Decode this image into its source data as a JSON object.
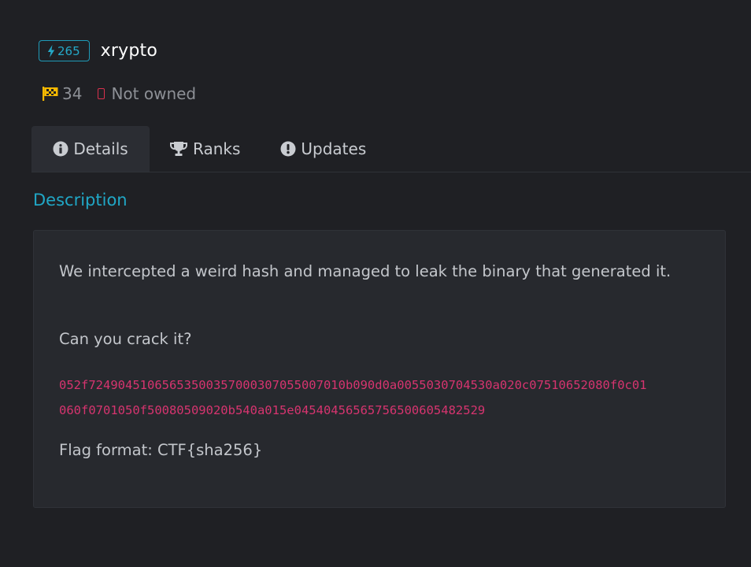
{
  "challenge": {
    "points": "265",
    "title": "xrypto",
    "solves": "34",
    "owned_status": "Not owned"
  },
  "tabs": [
    {
      "label": "Details",
      "icon": "info-circle-icon",
      "active": true
    },
    {
      "label": "Ranks",
      "icon": "trophy-icon",
      "active": false
    },
    {
      "label": "Updates",
      "icon": "exclamation-circle-icon",
      "active": false
    }
  ],
  "description": {
    "heading": "Description",
    "paragraph1": "We intercepted a weird hash and managed to leak the binary that generated it.",
    "paragraph2": "Can you crack it?",
    "hash_line1": "052f7249045106565350035700030705500701 0b090d0a0055030704530a020c07510652080f0c01",
    "hash_line2": "060f0701050f50080509020b540a015e04540456565756500605482529",
    "flag_format": "Flag format: CTF{sha256}"
  },
  "colors": {
    "accent": "#20a7c6",
    "badge": "#25a8c7",
    "hash": "#d6346f",
    "not_owned": "#d9314d",
    "flag": "#f5b800"
  }
}
